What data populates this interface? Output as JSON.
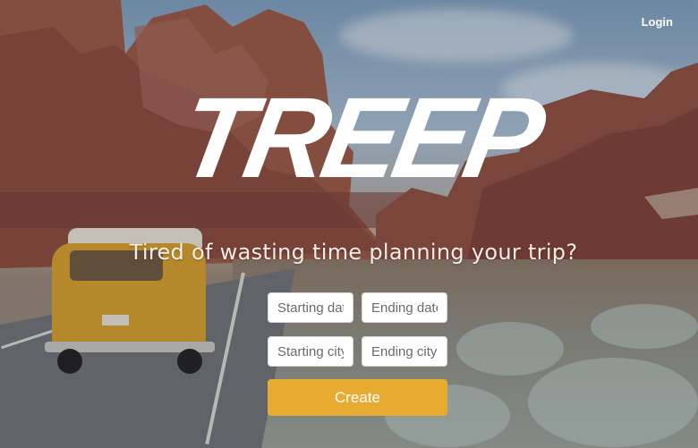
{
  "nav": {
    "login_label": "Login"
  },
  "hero": {
    "logo_text": "TREEP",
    "tagline": "Tired of wasting time planning your trip?"
  },
  "form": {
    "starting_date": {
      "placeholder": "Starting date",
      "value": ""
    },
    "ending_date": {
      "placeholder": "Ending date",
      "value": ""
    },
    "starting_city": {
      "placeholder": "Starting city",
      "value": ""
    },
    "ending_city": {
      "placeholder": "Ending city",
      "value": ""
    },
    "create_label": "Create"
  },
  "colors": {
    "accent": "#e8ab32",
    "logo": "#ffffff",
    "tagline": "#f1ece6"
  }
}
